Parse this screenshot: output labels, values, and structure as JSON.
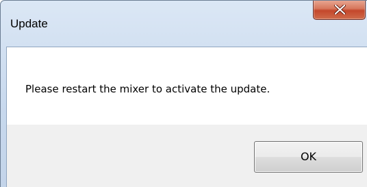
{
  "window": {
    "title": "Update",
    "close_icon": "close-x-icon"
  },
  "dialog": {
    "message": "Please restart the mixer to activate the update.",
    "ok_label": "OK"
  },
  "colors": {
    "close_button": "#c4472b",
    "frame": "#c7d8ed",
    "button_bar": "#f0f0f0"
  }
}
